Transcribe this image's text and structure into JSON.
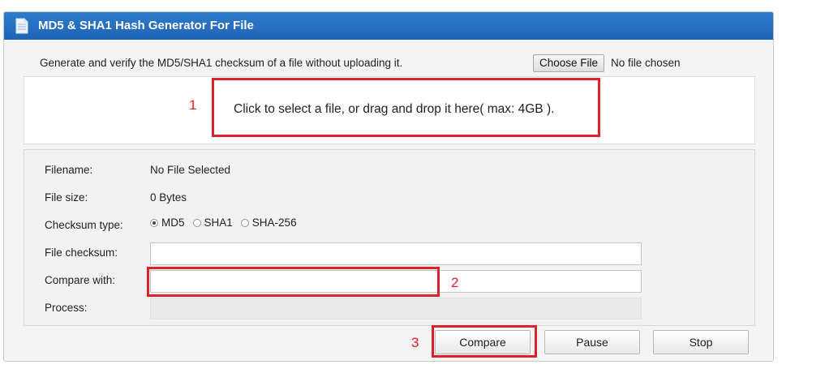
{
  "title": "MD5 & SHA1 Hash Generator For File",
  "intro_text": "Generate and verify the MD5/SHA1 checksum of a file without uploading it.",
  "choose_file_label": "Choose File",
  "no_file_chosen": "No file chosen",
  "dropzone_text": "Click to select a file, or drag and drop it here( max: 4GB ).",
  "details": {
    "filename_label": "Filename:",
    "filename_value": "No File Selected",
    "filesize_label": "File size:",
    "filesize_value": "0 Bytes",
    "checksum_type_label": "Checksum type:",
    "checksum_types": [
      "MD5",
      "SHA1",
      "SHA-256"
    ],
    "selected_checksum_type": "MD5",
    "file_checksum_label": "File checksum:",
    "file_checksum_value": "",
    "compare_with_label": "Compare with:",
    "compare_with_value": "",
    "process_label": "Process:",
    "process_progress": 0
  },
  "buttons": {
    "compare": "Compare",
    "pause": "Pause",
    "stop": "Stop"
  },
  "annotations": {
    "n1": "1",
    "n2": "2",
    "n3": "3"
  },
  "colors": {
    "header_blue": "#2f7ccd",
    "annotation_red": "#e0202a"
  }
}
